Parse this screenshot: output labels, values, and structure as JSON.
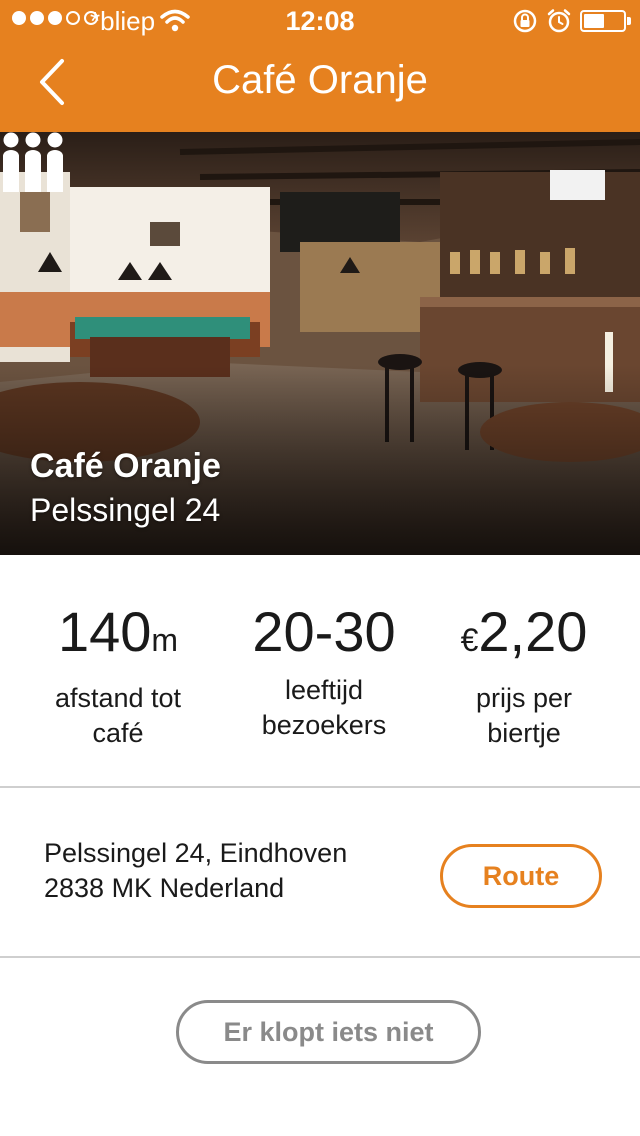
{
  "status": {
    "carrier": "*bliep",
    "time": "12:08",
    "signal_bars": 3,
    "signal_total": 5
  },
  "nav": {
    "title": "Café Oranje",
    "back_icon": "chevron-left-icon"
  },
  "hero": {
    "name": "Café Oranje",
    "address": "Pelssingel 24",
    "crowd_icon": "crowd-icon"
  },
  "stats": [
    {
      "value": "140",
      "unit": "m",
      "prefix": "",
      "label_line1": "afstand tot",
      "label_line2": "café"
    },
    {
      "value": "20-30",
      "unit": "",
      "prefix": "",
      "label_line1": "leeftijd",
      "label_line2": "bezoekers"
    },
    {
      "value": "2,20",
      "unit": "",
      "prefix": "€",
      "label_line1": "prijs per",
      "label_line2": "biertje"
    }
  ],
  "address": {
    "line1": "Pelssingel 24, Eindhoven",
    "line2": "2838 MK Nederland",
    "route_label": "Route"
  },
  "report_label": "Er klopt iets niet",
  "colors": {
    "accent": "#e6811f",
    "muted_button": "#8a8a8a",
    "divider": "#cfcfcf"
  }
}
